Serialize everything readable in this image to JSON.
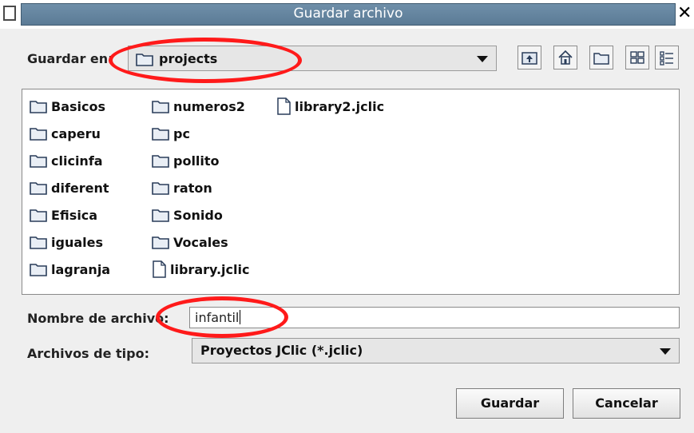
{
  "window": {
    "title": "Guardar archivo",
    "close_glyph": "✕"
  },
  "lookin": {
    "label": "Guardar en:",
    "value": "projects"
  },
  "toolbar": [
    {
      "name": "up-folder-icon"
    },
    {
      "name": "home-icon"
    },
    {
      "name": "new-folder-icon"
    },
    {
      "name": "list-view-icon"
    },
    {
      "name": "details-view-icon"
    }
  ],
  "files": [
    {
      "name": "Basicos",
      "type": "folder"
    },
    {
      "name": "caperu",
      "type": "folder"
    },
    {
      "name": "clicinfa",
      "type": "folder"
    },
    {
      "name": "diferent",
      "type": "folder"
    },
    {
      "name": "Efisica",
      "type": "folder"
    },
    {
      "name": "iguales",
      "type": "folder"
    },
    {
      "name": "lagranja",
      "type": "folder"
    },
    {
      "name": "numeros2",
      "type": "folder"
    },
    {
      "name": "pc",
      "type": "folder"
    },
    {
      "name": "pollito",
      "type": "folder"
    },
    {
      "name": "raton",
      "type": "folder"
    },
    {
      "name": "Sonido",
      "type": "folder"
    },
    {
      "name": "Vocales",
      "type": "folder"
    },
    {
      "name": "library.jclic",
      "type": "file"
    },
    {
      "name": "library2.jclic",
      "type": "file"
    }
  ],
  "filename": {
    "label": "Nombre de archivo:",
    "value": "infantil"
  },
  "filetype": {
    "label": "Archivos de tipo:",
    "value": "Proyectos JClic (*.jclic)"
  },
  "buttons": {
    "save": "Guardar",
    "cancel": "Cancelar"
  },
  "colors": {
    "annotation": "#ff1a1a",
    "titlebar": "#5f7f9a"
  }
}
